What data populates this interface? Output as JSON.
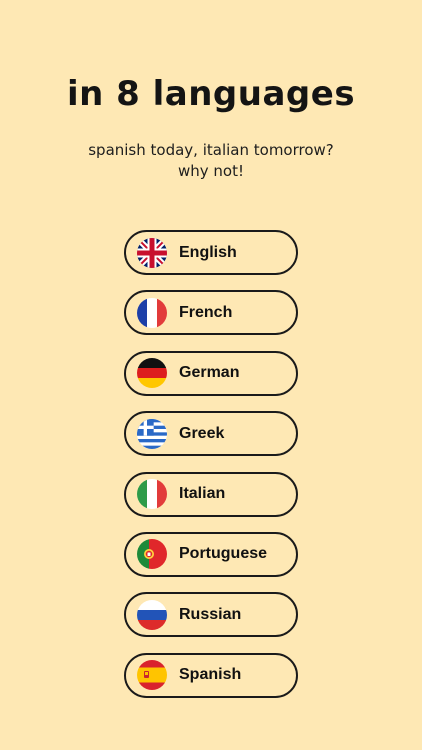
{
  "header": {
    "title": "in 8 languages",
    "subtitle_line1": "spanish today, italian tomorrow?",
    "subtitle_line2": "why not!"
  },
  "languages": [
    {
      "label": "English",
      "flag": "uk-flag-icon"
    },
    {
      "label": "French",
      "flag": "france-flag-icon"
    },
    {
      "label": "German",
      "flag": "germany-flag-icon"
    },
    {
      "label": "Greek",
      "flag": "greece-flag-icon"
    },
    {
      "label": "Italian",
      "flag": "italy-flag-icon"
    },
    {
      "label": "Portuguese",
      "flag": "portugal-flag-icon"
    },
    {
      "label": "Russian",
      "flag": "russia-flag-icon"
    },
    {
      "label": "Spanish",
      "flag": "spain-flag-icon"
    }
  ],
  "colors": {
    "background": "#FEE8B4",
    "text": "#141414",
    "border": "#1a1a1a"
  }
}
